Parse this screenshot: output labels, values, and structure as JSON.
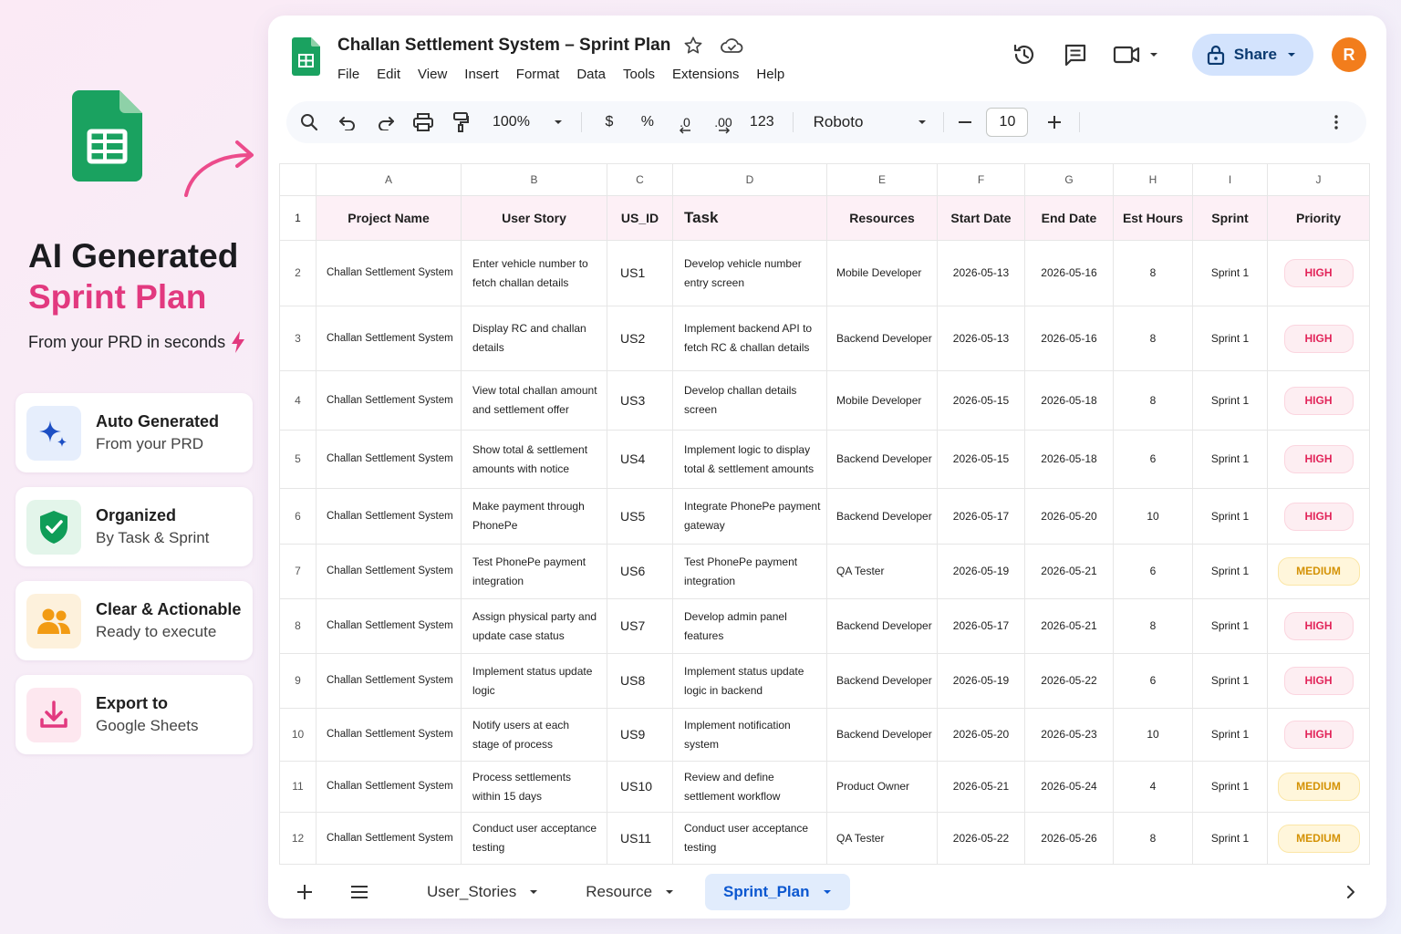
{
  "promo": {
    "title_line1": "AI Generated",
    "title_line2": "Sprint Plan",
    "subtitle": "From your PRD in seconds",
    "colors": {
      "accent": "#e2397f",
      "sheets_green": "#0f9d58"
    },
    "features": [
      {
        "title": "Auto Generated",
        "desc": "From your PRD",
        "icon": "sparkle-icon"
      },
      {
        "title": "Organized",
        "desc": "By Task & Sprint",
        "icon": "shield-check-icon"
      },
      {
        "title": "Clear & Actionable",
        "desc": "Ready to execute",
        "icon": "users-icon"
      },
      {
        "title": "Export to",
        "desc": "Google Sheets",
        "icon": "download-icon"
      }
    ]
  },
  "doc": {
    "title": "Challan Settlement System – Sprint Plan",
    "menu": [
      "File",
      "Edit",
      "View",
      "Insert",
      "Format",
      "Data",
      "Tools",
      "Extensions",
      "Help"
    ],
    "share_label": "Share",
    "avatar_initial": "R"
  },
  "toolbar": {
    "zoom": "100%",
    "currency": "$",
    "percent": "%",
    "dec_decrease": ".0",
    "dec_increase": ".00",
    "number_format": "123",
    "font": "Roboto",
    "font_size": "10"
  },
  "grid": {
    "column_letters": [
      "A",
      "B",
      "C",
      "D",
      "E",
      "F",
      "G",
      "H",
      "I",
      "J"
    ],
    "headers": [
      "Project Name",
      "User Story",
      "US_ID",
      "Task",
      "Resources",
      "Start Date",
      "End Date",
      "Est Hours",
      "Sprint",
      "Priority"
    ],
    "rows": [
      {
        "num": "2",
        "project": "Challan Settlement System",
        "story": "Enter vehicle number to fetch challan details",
        "usid": "US1",
        "task": "Develop vehicle number entry screen",
        "resource": "Mobile Developer",
        "start": "2026-05-13",
        "end": "2026-05-16",
        "hours": "8",
        "sprint": "Sprint 1",
        "priority": "HIGH"
      },
      {
        "num": "3",
        "project": "Challan Settlement System",
        "story": "Display RC and challan details",
        "usid": "US2",
        "task": "Implement backend API to fetch RC & challan details",
        "resource": "Backend Developer",
        "start": "2026-05-13",
        "end": "2026-05-16",
        "hours": "8",
        "sprint": "Sprint 1",
        "priority": "HIGH"
      },
      {
        "num": "4",
        "project": "Challan Settlement System",
        "story": "View total challan amount and settlement offer",
        "usid": "US3",
        "task": "Develop challan details screen",
        "resource": "Mobile Developer",
        "start": "2026-05-15",
        "end": "2026-05-18",
        "hours": "8",
        "sprint": "Sprint 1",
        "priority": "HIGH"
      },
      {
        "num": "5",
        "project": "Challan Settlement System",
        "story": "Show total & settlement amounts with notice",
        "usid": "US4",
        "task": "Implement logic to display total & settlement amounts",
        "resource": "Backend Developer",
        "start": "2026-05-15",
        "end": "2026-05-18",
        "hours": "6",
        "sprint": "Sprint 1",
        "priority": "HIGH"
      },
      {
        "num": "6",
        "project": "Challan Settlement System",
        "story": "Make payment through PhonePe",
        "usid": "US5",
        "task": "Integrate PhonePe payment gateway",
        "resource": "Backend Developer",
        "start": "2026-05-17",
        "end": "2026-05-20",
        "hours": "10",
        "sprint": "Sprint 1",
        "priority": "HIGH"
      },
      {
        "num": "7",
        "project": "Challan Settlement System",
        "story": "Test PhonePe payment integration",
        "usid": "US6",
        "task": "Test PhonePe payment integration",
        "resource": "QA Tester",
        "start": "2026-05-19",
        "end": "2026-05-21",
        "hours": "6",
        "sprint": "Sprint 1",
        "priority": "MEDIUM"
      },
      {
        "num": "8",
        "project": "Challan Settlement System",
        "story": "Assign physical party and update case status",
        "usid": "US7",
        "task": "Develop admin panel features",
        "resource": "Backend Developer",
        "start": "2026-05-17",
        "end": "2026-05-21",
        "hours": "8",
        "sprint": "Sprint 1",
        "priority": "HIGH"
      },
      {
        "num": "9",
        "project": "Challan Settlement System",
        "story": "Implement status update logic",
        "usid": "US8",
        "task": "Implement status update logic in backend",
        "resource": "Backend Developer",
        "start": "2026-05-19",
        "end": "2026-05-22",
        "hours": "6",
        "sprint": "Sprint 1",
        "priority": "HIGH"
      },
      {
        "num": "10",
        "project": "Challan Settlement System",
        "story": "Notify users at each stage of process",
        "usid": "US9",
        "task": "Implement notification system",
        "resource": "Backend Developer",
        "start": "2026-05-20",
        "end": "2026-05-23",
        "hours": "10",
        "sprint": "Sprint 1",
        "priority": "HIGH"
      },
      {
        "num": "11",
        "project": "Challan Settlement System",
        "story": "Process settlements within 15 days",
        "usid": "US10",
        "task": "Review and define settlement workflow",
        "resource": "Product Owner",
        "start": "2026-05-21",
        "end": "2026-05-24",
        "hours": "4",
        "sprint": "Sprint 1",
        "priority": "MEDIUM"
      },
      {
        "num": "12",
        "project": "Challan Settlement System",
        "story": "Conduct user acceptance testing",
        "usid": "US11",
        "task": "Conduct user acceptance testing",
        "resource": "QA Tester",
        "start": "2026-05-22",
        "end": "2026-05-26",
        "hours": "8",
        "sprint": "Sprint 1",
        "priority": "MEDIUM"
      }
    ]
  },
  "tabs": {
    "items": [
      "User_Stories",
      "Resource",
      "Sprint_Plan"
    ],
    "active": "Sprint_Plan"
  }
}
